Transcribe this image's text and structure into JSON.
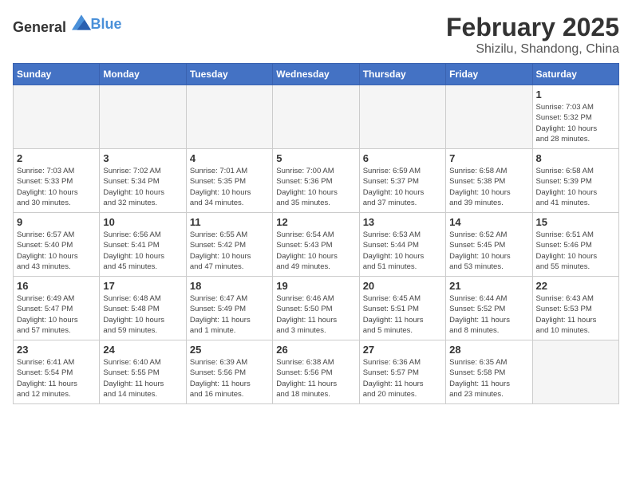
{
  "logo": {
    "text_general": "General",
    "text_blue": "Blue"
  },
  "title": "February 2025",
  "subtitle": "Shizilu, Shandong, China",
  "days_of_week": [
    "Sunday",
    "Monday",
    "Tuesday",
    "Wednesday",
    "Thursday",
    "Friday",
    "Saturday"
  ],
  "weeks": [
    [
      {
        "day": "",
        "info": ""
      },
      {
        "day": "",
        "info": ""
      },
      {
        "day": "",
        "info": ""
      },
      {
        "day": "",
        "info": ""
      },
      {
        "day": "",
        "info": ""
      },
      {
        "day": "",
        "info": ""
      },
      {
        "day": "1",
        "info": "Sunrise: 7:03 AM\nSunset: 5:32 PM\nDaylight: 10 hours\nand 28 minutes."
      }
    ],
    [
      {
        "day": "2",
        "info": "Sunrise: 7:03 AM\nSunset: 5:33 PM\nDaylight: 10 hours\nand 30 minutes."
      },
      {
        "day": "3",
        "info": "Sunrise: 7:02 AM\nSunset: 5:34 PM\nDaylight: 10 hours\nand 32 minutes."
      },
      {
        "day": "4",
        "info": "Sunrise: 7:01 AM\nSunset: 5:35 PM\nDaylight: 10 hours\nand 34 minutes."
      },
      {
        "day": "5",
        "info": "Sunrise: 7:00 AM\nSunset: 5:36 PM\nDaylight: 10 hours\nand 35 minutes."
      },
      {
        "day": "6",
        "info": "Sunrise: 6:59 AM\nSunset: 5:37 PM\nDaylight: 10 hours\nand 37 minutes."
      },
      {
        "day": "7",
        "info": "Sunrise: 6:58 AM\nSunset: 5:38 PM\nDaylight: 10 hours\nand 39 minutes."
      },
      {
        "day": "8",
        "info": "Sunrise: 6:58 AM\nSunset: 5:39 PM\nDaylight: 10 hours\nand 41 minutes."
      }
    ],
    [
      {
        "day": "9",
        "info": "Sunrise: 6:57 AM\nSunset: 5:40 PM\nDaylight: 10 hours\nand 43 minutes."
      },
      {
        "day": "10",
        "info": "Sunrise: 6:56 AM\nSunset: 5:41 PM\nDaylight: 10 hours\nand 45 minutes."
      },
      {
        "day": "11",
        "info": "Sunrise: 6:55 AM\nSunset: 5:42 PM\nDaylight: 10 hours\nand 47 minutes."
      },
      {
        "day": "12",
        "info": "Sunrise: 6:54 AM\nSunset: 5:43 PM\nDaylight: 10 hours\nand 49 minutes."
      },
      {
        "day": "13",
        "info": "Sunrise: 6:53 AM\nSunset: 5:44 PM\nDaylight: 10 hours\nand 51 minutes."
      },
      {
        "day": "14",
        "info": "Sunrise: 6:52 AM\nSunset: 5:45 PM\nDaylight: 10 hours\nand 53 minutes."
      },
      {
        "day": "15",
        "info": "Sunrise: 6:51 AM\nSunset: 5:46 PM\nDaylight: 10 hours\nand 55 minutes."
      }
    ],
    [
      {
        "day": "16",
        "info": "Sunrise: 6:49 AM\nSunset: 5:47 PM\nDaylight: 10 hours\nand 57 minutes."
      },
      {
        "day": "17",
        "info": "Sunrise: 6:48 AM\nSunset: 5:48 PM\nDaylight: 10 hours\nand 59 minutes."
      },
      {
        "day": "18",
        "info": "Sunrise: 6:47 AM\nSunset: 5:49 PM\nDaylight: 11 hours\nand 1 minute."
      },
      {
        "day": "19",
        "info": "Sunrise: 6:46 AM\nSunset: 5:50 PM\nDaylight: 11 hours\nand 3 minutes."
      },
      {
        "day": "20",
        "info": "Sunrise: 6:45 AM\nSunset: 5:51 PM\nDaylight: 11 hours\nand 5 minutes."
      },
      {
        "day": "21",
        "info": "Sunrise: 6:44 AM\nSunset: 5:52 PM\nDaylight: 11 hours\nand 8 minutes."
      },
      {
        "day": "22",
        "info": "Sunrise: 6:43 AM\nSunset: 5:53 PM\nDaylight: 11 hours\nand 10 minutes."
      }
    ],
    [
      {
        "day": "23",
        "info": "Sunrise: 6:41 AM\nSunset: 5:54 PM\nDaylight: 11 hours\nand 12 minutes."
      },
      {
        "day": "24",
        "info": "Sunrise: 6:40 AM\nSunset: 5:55 PM\nDaylight: 11 hours\nand 14 minutes."
      },
      {
        "day": "25",
        "info": "Sunrise: 6:39 AM\nSunset: 5:56 PM\nDaylight: 11 hours\nand 16 minutes."
      },
      {
        "day": "26",
        "info": "Sunrise: 6:38 AM\nSunset: 5:56 PM\nDaylight: 11 hours\nand 18 minutes."
      },
      {
        "day": "27",
        "info": "Sunrise: 6:36 AM\nSunset: 5:57 PM\nDaylight: 11 hours\nand 20 minutes."
      },
      {
        "day": "28",
        "info": "Sunrise: 6:35 AM\nSunset: 5:58 PM\nDaylight: 11 hours\nand 23 minutes."
      },
      {
        "day": "",
        "info": ""
      }
    ]
  ]
}
